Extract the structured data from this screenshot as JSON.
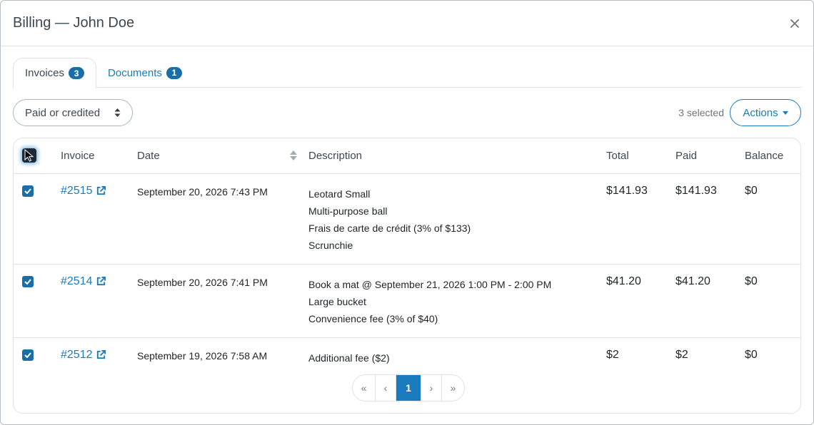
{
  "modal": {
    "title": "Billing — John Doe"
  },
  "tabs": [
    {
      "label": "Invoices",
      "count": "3"
    },
    {
      "label": "Documents",
      "count": "1"
    }
  ],
  "filter": {
    "selected": "Paid or credited"
  },
  "selection": {
    "count_text": "3 selected"
  },
  "actions": {
    "label": "Actions"
  },
  "table": {
    "headers": {
      "invoice": "Invoice",
      "date": "Date",
      "description": "Description",
      "total": "Total",
      "paid": "Paid",
      "balance": "Balance"
    },
    "rows": [
      {
        "invoice": "#2515",
        "date": "September 20, 2026 7:43 PM",
        "description": [
          "Leotard Small",
          "Multi-purpose ball",
          "Frais de carte de crédit (3% of $133)",
          "Scrunchie"
        ],
        "total": "$141.93",
        "paid": "$141.93",
        "balance": "$0"
      },
      {
        "invoice": "#2514",
        "date": "September 20, 2026 7:41 PM",
        "description": [
          "Book a mat @ September 21, 2026 1:00 PM - 2:00 PM",
          "Large bucket",
          "Convenience fee (3% of $40)"
        ],
        "total": "$41.20",
        "paid": "$41.20",
        "balance": "$0"
      },
      {
        "invoice": "#2512",
        "date": "September 19, 2026 7:58 AM",
        "description": [
          "Additional fee ($2)"
        ],
        "total": "$2",
        "paid": "$2",
        "balance": "$0"
      }
    ]
  },
  "pagination": {
    "first": "«",
    "prev": "‹",
    "current": "1",
    "next": "›",
    "last": "»"
  },
  "colors": {
    "accent": "#1a7bbd",
    "badge": "#1a6ea8",
    "border": "#dee2e6"
  }
}
